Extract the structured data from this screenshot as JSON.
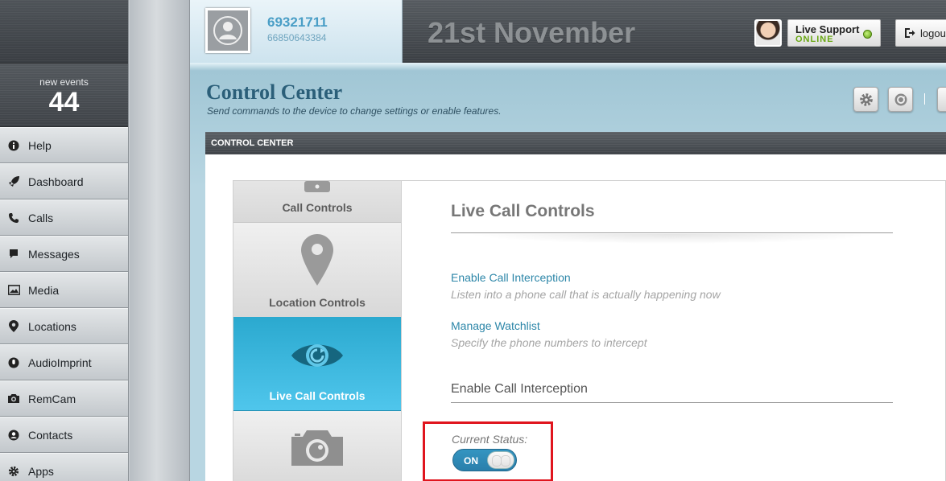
{
  "sidebar": {
    "events_label": "new events",
    "events_count": "44",
    "items": [
      {
        "label": "Help",
        "icon": "info-icon"
      },
      {
        "label": "Dashboard",
        "icon": "rocket-icon"
      },
      {
        "label": "Calls",
        "icon": "phone-icon"
      },
      {
        "label": "Messages",
        "icon": "speech-bubble-icon"
      },
      {
        "label": "Media",
        "icon": "image-icon"
      },
      {
        "label": "Locations",
        "icon": "map-pin-icon"
      },
      {
        "label": "AudioImprint",
        "icon": "microphone-icon"
      },
      {
        "label": "RemCam",
        "icon": "camera-icon"
      },
      {
        "label": "Contacts",
        "icon": "contacts-icon"
      },
      {
        "label": "Apps",
        "icon": "gear-icon"
      }
    ]
  },
  "header": {
    "account_id": "69321711",
    "account_phone": "66850643384",
    "date": "21st November",
    "support_title": "Live Support",
    "support_status": "ONLINE",
    "logout_label": "logou"
  },
  "page": {
    "title": "Control Center",
    "subtitle": "Send commands to the device to change settings or enable features.",
    "panel_header": "CONTROL CENTER"
  },
  "tabs": [
    {
      "label": "Call Controls",
      "icon": "phone-icon"
    },
    {
      "label": "Location Controls",
      "icon": "map-pin-icon"
    },
    {
      "label": "Live Call Controls",
      "icon": "eye-icon",
      "active": true
    },
    {
      "label": "",
      "icon": "camera-icon"
    }
  ],
  "content": {
    "title": "Live Call Controls",
    "actions": [
      {
        "link": "Enable Call Interception",
        "description": "Listen into a phone call that is actually happening now"
      },
      {
        "link": "Manage Watchlist",
        "description": "Specify the phone numbers to intercept"
      }
    ],
    "section_title": "Enable Call Interception",
    "status_label": "Current Status:",
    "toggle_label": "ON"
  },
  "colors": {
    "accent": "#2ba9cf",
    "link": "#2c86a8",
    "highlight_box": "#e0151e",
    "online": "#6aa814"
  }
}
